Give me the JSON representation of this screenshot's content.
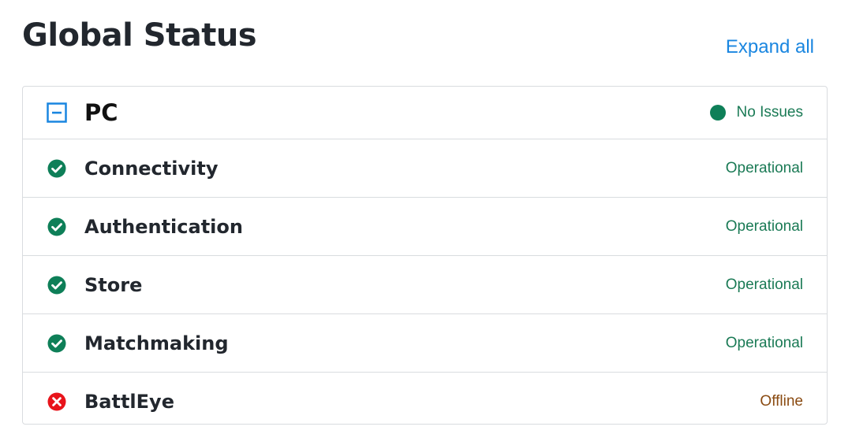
{
  "page": {
    "title": "Global Status",
    "expand_all_label": "Expand all"
  },
  "platform": {
    "name": "PC",
    "summary_status": "No Issues",
    "toggle_icon": "collapse-minus-icon"
  },
  "services": [
    {
      "name": "Connectivity",
      "status": "Operational",
      "icon": "check-circle-icon",
      "state": "ok"
    },
    {
      "name": "Authentication",
      "status": "Operational",
      "icon": "check-circle-icon",
      "state": "ok"
    },
    {
      "name": "Store",
      "status": "Operational",
      "icon": "check-circle-icon",
      "state": "ok"
    },
    {
      "name": "Matchmaking",
      "status": "Operational",
      "icon": "check-circle-icon",
      "state": "ok"
    },
    {
      "name": "BattlEye",
      "status": "Offline",
      "icon": "error-x-circle-icon",
      "state": "offline"
    }
  ],
  "colors": {
    "accent": "#1a86e0",
    "operational": "#1a7a55",
    "ok_icon": "#0e7f58",
    "offline_text": "#8a4b12",
    "offline_icon": "#e8141b"
  }
}
